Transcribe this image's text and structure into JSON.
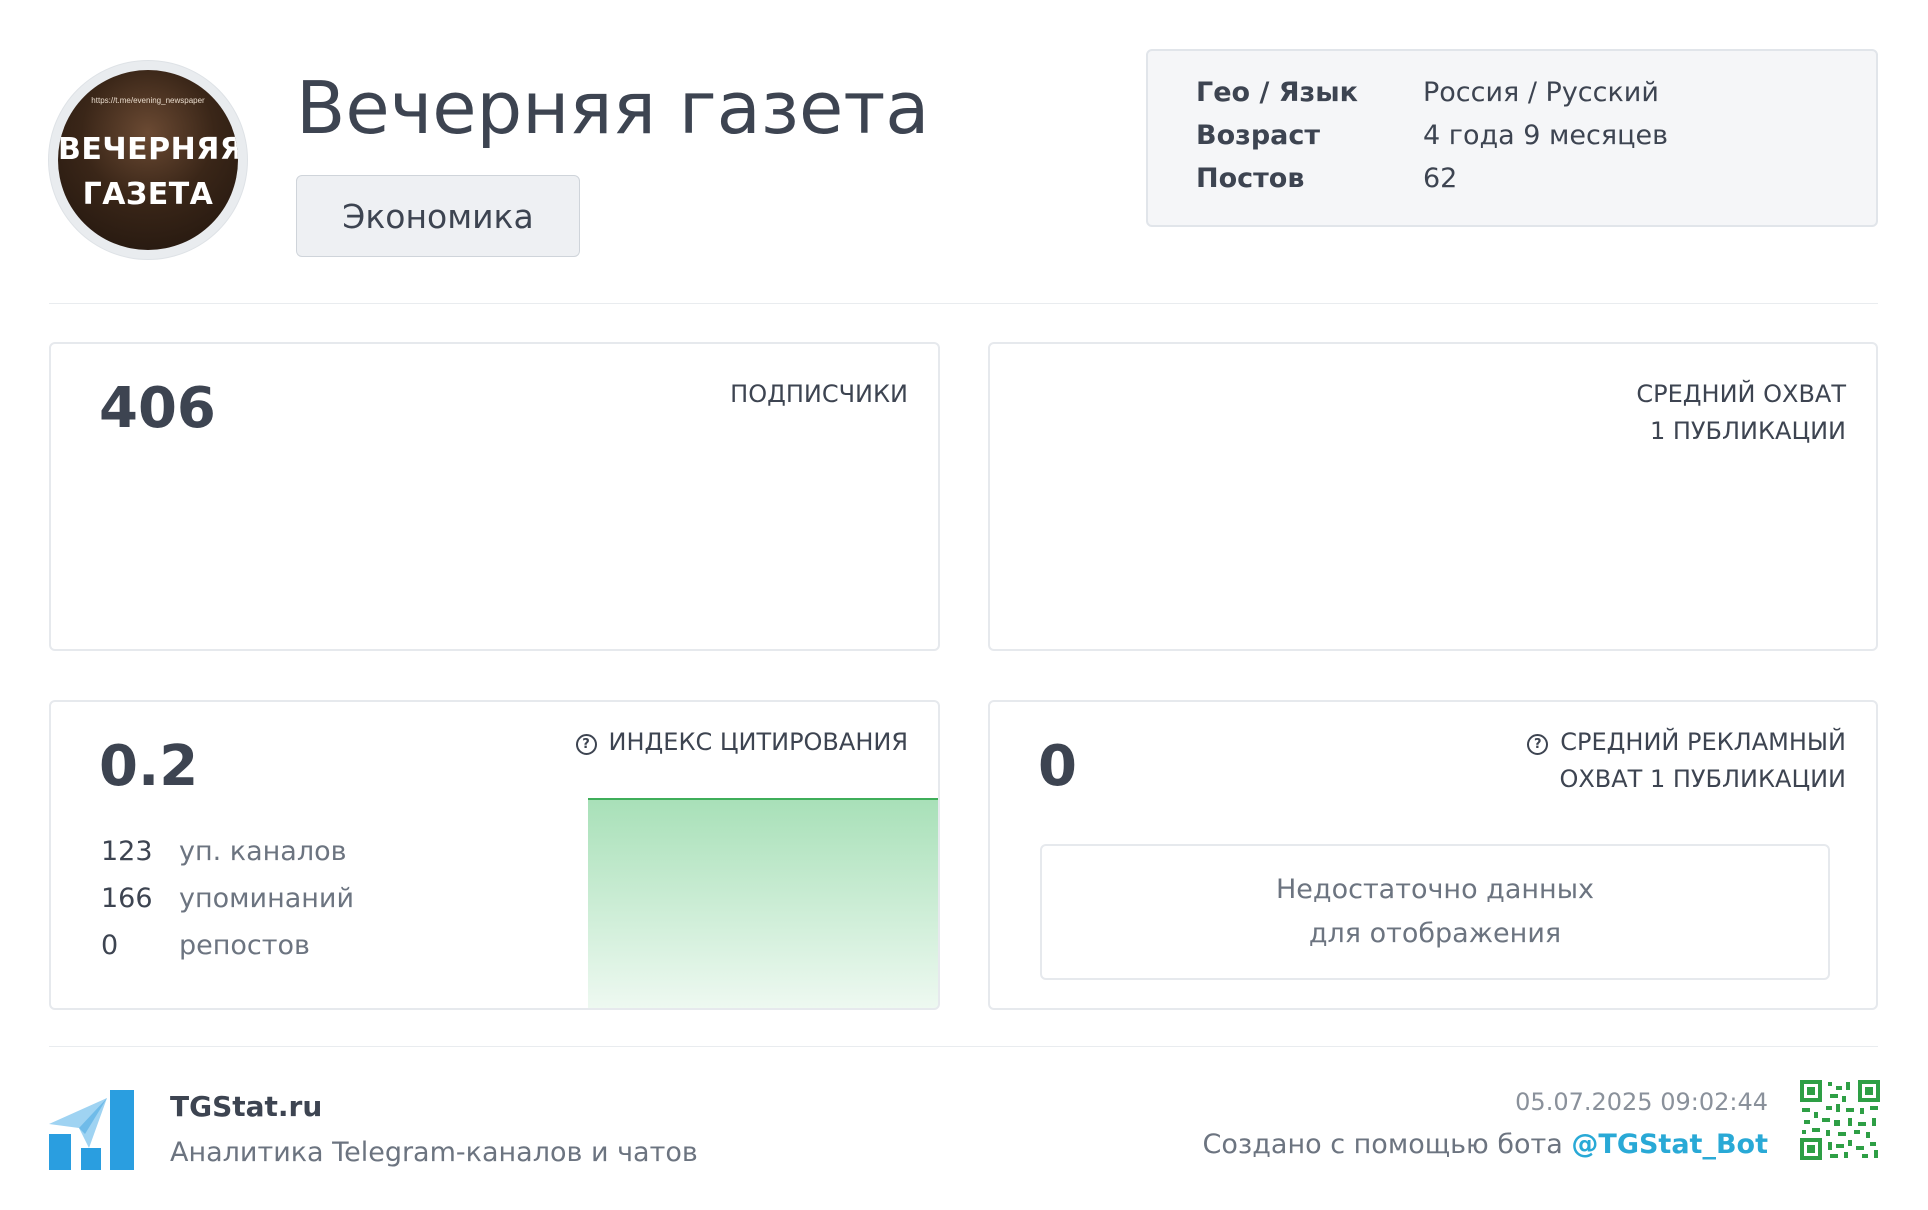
{
  "channel": {
    "avatar_url_text": "https://t.me/evening_newspaper",
    "avatar_line1": "ВЕЧЕРНЯЯ",
    "avatar_line2": "ГАЗЕТА",
    "title": "Вечерняя газета",
    "category": "Экономика"
  },
  "info": [
    {
      "label": "Гео / Язык",
      "value": "Россия / Русский"
    },
    {
      "label": "Возраст",
      "value": "4 года 9 месяцев"
    },
    {
      "label": "Постов",
      "value": "62"
    }
  ],
  "subscribers": {
    "value": "406",
    "label": "ПОДПИСЧИКИ"
  },
  "avg_reach": {
    "label_line1": "СРЕДНИЙ ОХВАТ",
    "label_line2": "1 ПУБЛИКАЦИИ"
  },
  "citation": {
    "value": "0.2",
    "label": "ИНДЕКС ЦИТИРОВАНИЯ",
    "rows": [
      {
        "num": "123",
        "text": "уп. каналов"
      },
      {
        "num": "166",
        "text": "упоминаний"
      },
      {
        "num": "0",
        "text": "репостов"
      }
    ]
  },
  "ad_reach": {
    "value": "0",
    "label_line1": "СРЕДНИЙ РЕКЛАМНЫЙ",
    "label_line2": "ОХВАТ 1 ПУБЛИКАЦИИ",
    "nodata_line1": "Недостаточно данных",
    "nodata_line2": "для отображения"
  },
  "footer": {
    "brand": "TGStat.ru",
    "tagline": "Аналитика Telegram-каналов и чатов",
    "timestamp": "05.07.2025 09:02:44",
    "created_prefix": "Создано с помощью бота ",
    "bot": "@TGStat_Bot"
  },
  "colors": {
    "text": "#3d4451",
    "muted": "#6c7480",
    "accent": "#29a9d6",
    "chart_line": "#3fae5a",
    "chart_fill": "#a8e0b8",
    "logo_blue": "#2a9ee0"
  }
}
